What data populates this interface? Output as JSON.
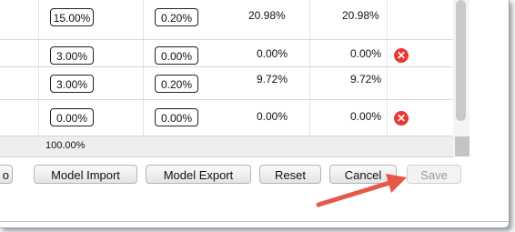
{
  "table": {
    "rows": [
      {
        "col1": "15.00%",
        "col2": "0.20%",
        "col3": "20.98%",
        "col4": "20.98%",
        "removable": false
      },
      {
        "col1": "3.00%",
        "col2": "0.00%",
        "col3": "0.00%",
        "col4": "0.00%",
        "removable": true
      },
      {
        "col1": "3.00%",
        "col2": "0.20%",
        "col3": "9.72%",
        "col4": "9.72%",
        "removable": false
      },
      {
        "col1": "0.00%",
        "col2": "0.00%",
        "col3": "0.00%",
        "col4": "0.00%",
        "removable": true
      }
    ],
    "total": "100.00%",
    "remove_glyph": "✕"
  },
  "toolbar": {
    "partial_label": "o",
    "model_import": "Model Import",
    "model_export": "Model Export",
    "reset": "Reset",
    "cancel": "Cancel",
    "save": "Save"
  },
  "colors": {
    "arrow": "#e8584a",
    "remove": "#e53935"
  }
}
